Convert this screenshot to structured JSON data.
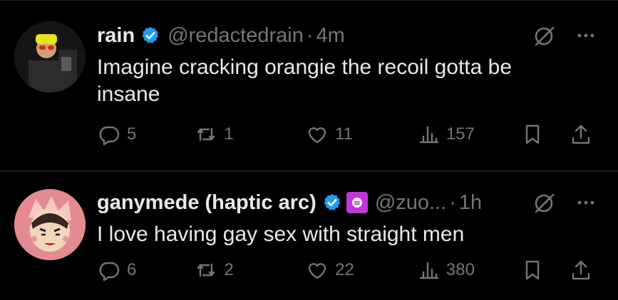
{
  "tweets": [
    {
      "name": "rain",
      "handle": "@redactedrain",
      "separator": "·",
      "time": "4m",
      "text": "Imagine cracking orangie the recoil gotta be insane",
      "replies": "5",
      "reposts": "1",
      "likes": "11",
      "views": "157",
      "verified": true
    },
    {
      "name": "ganymede (haptic arc)",
      "handle": "@zuo...",
      "separator": "·",
      "time": "1h",
      "text": "I love having gay sex with straight men",
      "replies": "6",
      "reposts": "2",
      "likes": "22",
      "views": "380",
      "verified": true,
      "affiliate_badge_color": "#c138d6"
    }
  ],
  "colors": {
    "background": "#000000",
    "text": "#e7e9ea",
    "secondary": "#71767b",
    "verified": "#1d9bf0"
  }
}
